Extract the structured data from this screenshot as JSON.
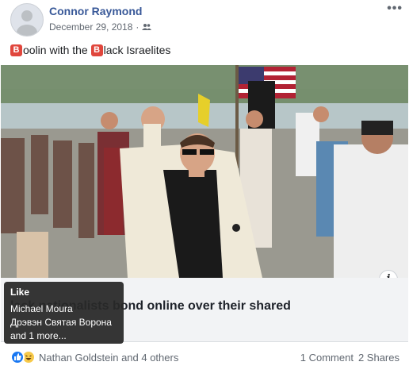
{
  "post": {
    "author": "Connor Raymond",
    "date": "December 29, 2018",
    "separator": "·",
    "audience_icon": "friends-icon",
    "more_label": "•••",
    "text": {
      "emoji_1": "B",
      "part_1": "oolin with the ",
      "emoji_2": "B",
      "part_2": "lack Israelites"
    }
  },
  "link_preview": {
    "title": "lack nationalists bond online over their shared"
  },
  "tooltip": {
    "title": "Like",
    "lines": [
      "Michael Moura",
      "Дрэвэн Святая Ворона",
      "and 1 more..."
    ]
  },
  "reactions": {
    "summary": "Nathan Goldstein and 4 others",
    "comments": "1 Comment",
    "shares": "2 Shares",
    "colors": {
      "like": "#1877f2",
      "haha": "#f7c94a"
    }
  }
}
